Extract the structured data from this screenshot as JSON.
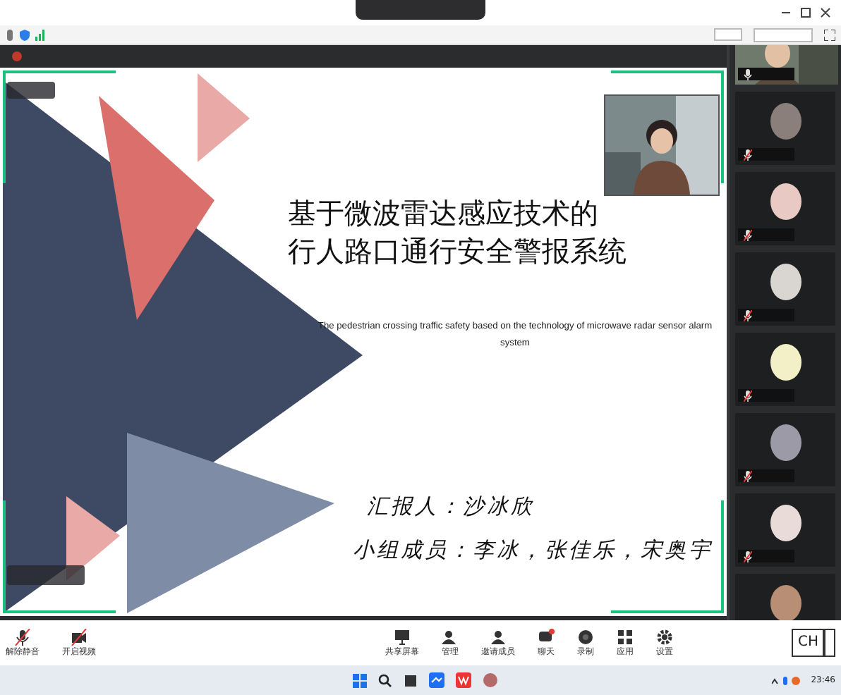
{
  "slide": {
    "title_lines": [
      "基于微波雷达感应技术的",
      "行人路口通行安全警报系统"
    ],
    "subtitle": "The pedestrian crossing traffic safety based on the technology of microwave radar sensor alarm system",
    "presenter": "汇报人：沙冰欣",
    "members": "小组成员：李冰，张佳乐，宋奥宇"
  },
  "participants": [
    {
      "kind": "video",
      "muted": false
    },
    {
      "kind": "avatar",
      "muted": true,
      "color": "#8a7f7a"
    },
    {
      "kind": "avatar",
      "muted": true,
      "color": "#e8c9c4"
    },
    {
      "kind": "avatar",
      "muted": true,
      "color": "#d9d6d2"
    },
    {
      "kind": "avatar",
      "muted": true,
      "color": "#f3f0c8"
    },
    {
      "kind": "avatar",
      "muted": true,
      "color": "#9b9aa6"
    },
    {
      "kind": "avatar",
      "muted": true,
      "color": "#e9dcd8"
    },
    {
      "kind": "avatar",
      "color": "#b88f74"
    }
  ],
  "toolbar_left": [
    {
      "label": "解除静音"
    },
    {
      "label": "开启视频"
    }
  ],
  "toolbar_center": [
    {
      "label": "共享屏幕"
    },
    {
      "label": "管理"
    },
    {
      "label": "邀请成员"
    },
    {
      "label": "聊天"
    },
    {
      "label": "录制"
    },
    {
      "label": "应用"
    },
    {
      "label": "设置"
    }
  ],
  "language": "CH",
  "clock": "23:46"
}
